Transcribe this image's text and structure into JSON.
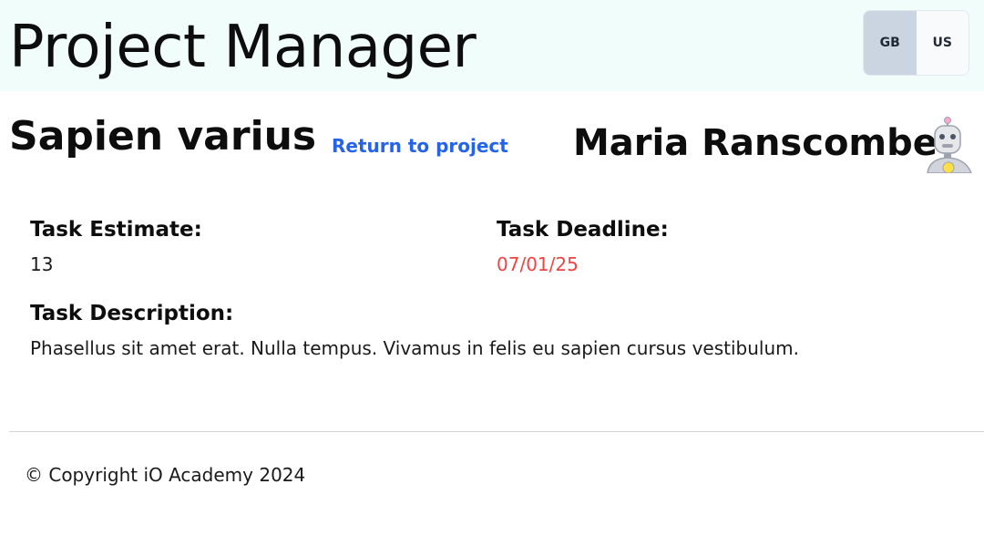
{
  "header": {
    "app_title": "Project Manager",
    "locales": [
      {
        "label": "GB",
        "active": true
      },
      {
        "label": "US",
        "active": false
      }
    ]
  },
  "task": {
    "name": "Sapien varius",
    "return_link": "Return to project",
    "assignee": "Maria Ranscombe",
    "avatar_icon": "robot-avatar-icon",
    "estimate_label": "Task Estimate:",
    "estimate_value": "13",
    "deadline_label": "Task Deadline:",
    "deadline_value": "07/01/25",
    "description_label": "Task Description:",
    "description_value": "Phasellus sit amet erat. Nulla tempus. Vivamus in felis eu sapien cursus vestibulum."
  },
  "footer": {
    "copyright": "© Copyright iO Academy 2024"
  },
  "colors": {
    "header_bg": "#f0fdfa",
    "link": "#2563eb",
    "deadline": "#ef4444",
    "active_locale_bg": "#cbd5e1"
  }
}
